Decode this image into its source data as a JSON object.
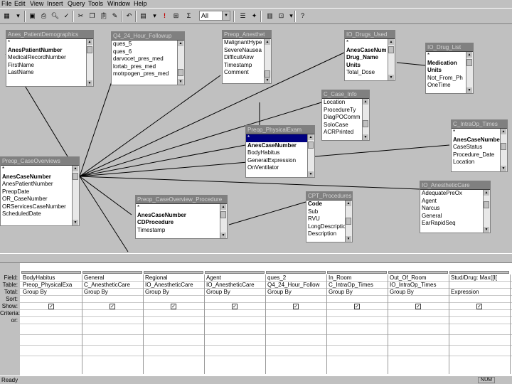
{
  "menu": [
    "File",
    "Edit",
    "View",
    "Insert",
    "Query",
    "Tools",
    "Window",
    "Help"
  ],
  "toolbar": {
    "top_values_value": "All",
    "exclamation_label": "!",
    "sigma_label": "Σ"
  },
  "tables": [
    {
      "title": "Anes_PatientDemographics",
      "fields": [
        "*",
        "AnesPatientNumber",
        "MedicalRecordNumber",
        "FirstName",
        "LastName"
      ],
      "bold": [
        1
      ]
    },
    {
      "title": "Q4_24_Hour_Followup",
      "fields": [
        "ques_5",
        "ques_6",
        "darvocet_pres_med",
        "lortab_pres_med",
        "motrpogen_pres_med"
      ],
      "bold": []
    },
    {
      "title": "Preop_Anesthet",
      "fields": [
        "MalignantHype",
        "SevereNausea",
        "DifficultAirw",
        "Timestamp",
        "Comment"
      ],
      "bold": []
    },
    {
      "title": "IO_Drugs_Used",
      "fields": [
        "*",
        "AnesCaseNum",
        "Drug_Name",
        "Units",
        "Total_Dose"
      ],
      "bold": [
        1,
        2,
        3
      ]
    },
    {
      "title": "IO_Drug_List",
      "fields": [
        "*",
        "Medication",
        "Units",
        "Not_From_Ph",
        "OneTime"
      ],
      "bold": [
        1,
        2
      ]
    },
    {
      "title": "C_Case_Info",
      "fields": [
        "Location",
        "ProcedureTy",
        "DiagPOComm",
        "SoloCase",
        "ACRPrinted"
      ],
      "bold": []
    },
    {
      "title": "Preop_PhysicalExam",
      "fields": [
        "*",
        "AnesCaseNumber",
        "BodyHabitus",
        "GeneralExpression",
        "OnVentilator"
      ],
      "bold": [
        1
      ]
    },
    {
      "title": "C_IntraOp_Times",
      "fields": [
        "*",
        "AnesCaseNumber",
        "CaseStatus",
        "Procedure_Date",
        "Location"
      ],
      "bold": [
        1
      ]
    },
    {
      "title": "Preop_CaseOverviews",
      "fields": [
        "*",
        "AnesCaseNumber",
        "AnesPatientNumber",
        "PreopDate",
        "OR_CaseNumber",
        "ORServicesCaseNumber",
        "ScheduledDate"
      ],
      "bold": [
        1
      ]
    },
    {
      "title": "Preop_CaseOverview_Procedure",
      "fields": [
        "*",
        "AnesCaseNumber",
        "CDProcedure",
        "Timestamp"
      ],
      "bold": [
        1,
        2
      ]
    },
    {
      "title": "CPT_Procedures",
      "fields": [
        "Code",
        "Sub",
        "RVU",
        "LongDescription",
        "Description"
      ],
      "bold": []
    },
    {
      "title": "IO_AnestheticCare",
      "fields": [
        "AdequatePreOx",
        "Agent",
        "Narcus",
        "General",
        "EarRapidSeq"
      ],
      "bold": []
    }
  ],
  "grid": {
    "row_labels": [
      "Field:",
      "Table:",
      "Total:",
      "Sort:",
      "Show:",
      "Criteria:",
      "or:"
    ],
    "columns": [
      {
        "field": "BodyHabitus",
        "table": "Preop_PhysicalExa",
        "total": "Group By",
        "show": true
      },
      {
        "field": "General",
        "table": "C_AnestheticCare",
        "total": "Group By",
        "show": true
      },
      {
        "field": "Regional",
        "table": "IO_AnestheticCare",
        "total": "Group By",
        "show": true
      },
      {
        "field": "Agent",
        "table": "IO_AnestheticCare",
        "total": "Group By",
        "show": true
      },
      {
        "field": "ques_2",
        "table": "Q4_24_Hour_Follow",
        "total": "Group By",
        "show": true
      },
      {
        "field": "In_Room",
        "table": "C_IntraOp_Times",
        "total": "Group By",
        "show": true
      },
      {
        "field": "Out_Of_Room",
        "table": "IO_IntraOp_Times",
        "total": "Group By",
        "show": true
      },
      {
        "field": "Stud/Drug: Max([I[",
        "table": "",
        "total": "Expression",
        "show": true
      }
    ]
  },
  "status": {
    "left": "Ready",
    "num": "NUM"
  }
}
